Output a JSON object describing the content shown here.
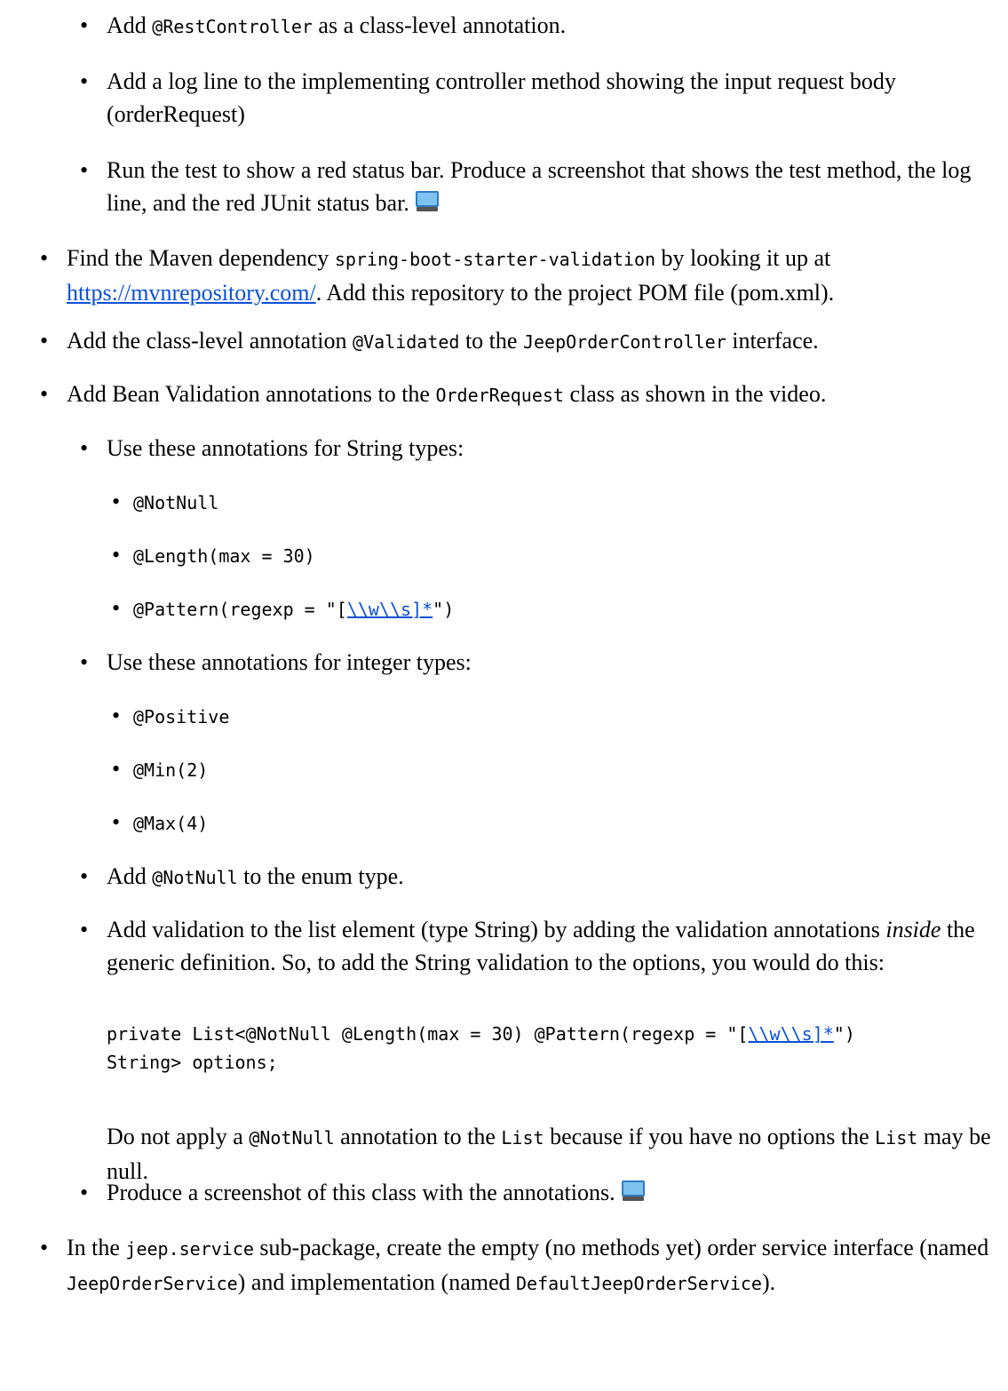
{
  "items": {
    "a1": {
      "pre": "Add ",
      "code": "@RestController",
      "post": " as a class-level annotation."
    },
    "a2": {
      "text": "Add a log line to the implementing controller method showing the input request body (orderRequest)"
    },
    "a3": {
      "text": "Run the test to show a red status bar. Produce a screenshot that shows the test method, the log line, and the red JUnit status bar."
    },
    "b1": {
      "pre": "Find the Maven dependency ",
      "code": "spring-boot-starter-validation",
      "mid": " by looking it up at ",
      "link": "https://mvnrepository.com/",
      "post": ". Add this repository to the project POM file (pom.xml)."
    },
    "b2": {
      "pre": "Add the class-level annotation ",
      "code1": "@Validated",
      "mid": " to the ",
      "code2": "JeepOrderController",
      "post": " interface."
    },
    "b3": {
      "pre": "Add Bean Validation annotations to the ",
      "code": "OrderRequest",
      "post": " class as shown in the video."
    },
    "c1": {
      "text": "Use these annotations for String types:"
    },
    "s1": "@NotNull",
    "s2": "@Length(max = 30)",
    "s3": {
      "pre": "@Pattern(regexp = \"[",
      "link": "\\\\w\\\\s]*",
      "post": "\")"
    },
    "c2": {
      "text": "Use these annotations for integer types:"
    },
    "i1": "@Positive",
    "i2": "@Min(2)",
    "i3": "@Max(4)",
    "c3": {
      "pre": "Add ",
      "code": "@NotNull",
      "post": " to the enum type."
    },
    "c4": {
      "pre": "Add validation to the list element (type String) by adding the validation annotations ",
      "em": "inside",
      "post": " the generic definition. So, to add the String validation to the options, you would do this:"
    },
    "code_line1_pre": "private List<@NotNull @Length(max = 30) @Pattern(regexp = \"[",
    "code_line1_link": "\\\\w\\\\s]*",
    "code_line1_post": "\")",
    "code_line2": "String> options;",
    "p1": {
      "pre": "Do not apply a ",
      "code1": "@NotNull",
      "mid": " annotation to the ",
      "code2": "List",
      "mid2": " because if you have no options the ",
      "code3": "List",
      "post": " may be null."
    },
    "c5": {
      "text": "Produce a screenshot of this class with the annotations."
    },
    "b4": {
      "pre": "In the ",
      "code1": "jeep.service",
      "mid": " sub-package, create the empty (no methods yet) order service interface (named ",
      "code2": "JeepOrderService",
      "mid2": ") and implementation (named ",
      "code3": "DefaultJeepOrderService",
      "post": ")."
    }
  },
  "bullet_char": "•",
  "icons": {
    "screenshot": "monitor-icon"
  }
}
